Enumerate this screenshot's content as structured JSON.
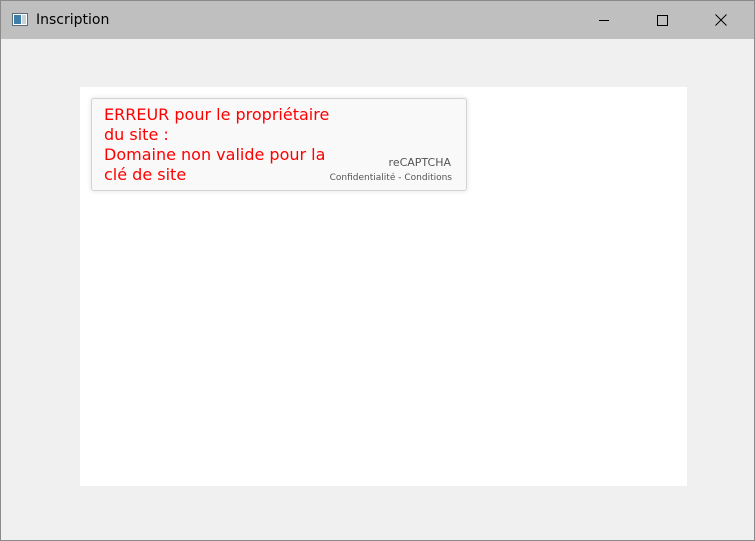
{
  "window": {
    "title": "Inscription",
    "controls": {
      "minimize": "minimize-icon",
      "maximize": "maximize-icon",
      "close": "close-icon"
    }
  },
  "recaptcha": {
    "error_lines": [
      "ERREUR pour le propriétaire",
      "du site :",
      "Domaine non valide pour la",
      "clé de site"
    ],
    "brand": "reCAPTCHA",
    "privacy_link": "Confidentialité",
    "separator": " - ",
    "terms_link": "Conditions"
  },
  "colors": {
    "titlebar": "#bfbfbf",
    "window_bg": "#f0f0f0",
    "content_bg": "#ffffff",
    "error_text": "#ff0000",
    "recaptcha_bg": "#f9f9f9"
  }
}
